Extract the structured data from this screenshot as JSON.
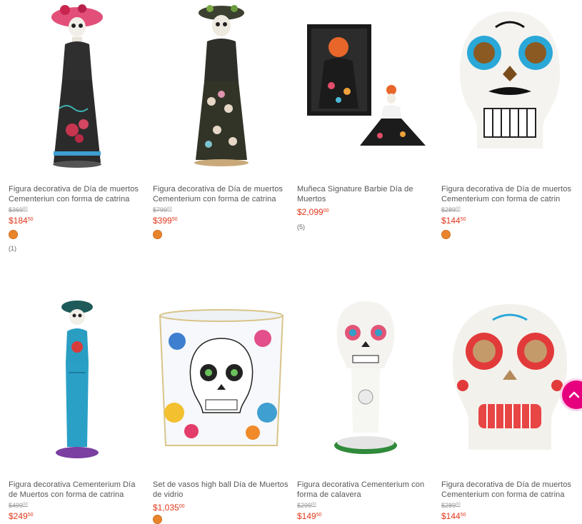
{
  "products": [
    {
      "title": "Figura decorativa de Día de muertos Cementeriun con forma de catrina",
      "old_price": "$369",
      "old_cents": "00",
      "price": "$184",
      "price_cents": "50",
      "has_swatch": true,
      "reviews": "(1)"
    },
    {
      "title": "Figura decorativa de Día de muertos Cementerium con forma de catrina",
      "old_price": "$799",
      "old_cents": "00",
      "price": "$399",
      "price_cents": "50",
      "has_swatch": true,
      "reviews": ""
    },
    {
      "title": "Muñeca Signature Barbie Día de Muertos",
      "old_price": "",
      "old_cents": "",
      "price": "$2,099",
      "price_cents": "00",
      "has_swatch": false,
      "reviews": "(5)"
    },
    {
      "title": "Figura decorativa de Día de muertos Cementerium con forma de catrin",
      "old_price": "$289",
      "old_cents": "00",
      "price": "$144",
      "price_cents": "50",
      "has_swatch": true,
      "reviews": ""
    },
    {
      "title": "Figura decorativa Cementerium Día de Muertos con forma de catrina",
      "old_price": "$499",
      "old_cents": "00",
      "price": "$249",
      "price_cents": "50",
      "has_swatch": false,
      "reviews": ""
    },
    {
      "title": "Set de vasos high ball Día de Muertos de vidrio",
      "old_price": "",
      "old_cents": "",
      "price": "$1,035",
      "price_cents": "00",
      "has_swatch": true,
      "reviews": ""
    },
    {
      "title": "Figura decorativa Cementerium con forma de calavera",
      "old_price": "$299",
      "old_cents": "00",
      "price": "$149",
      "price_cents": "50",
      "has_swatch": false,
      "reviews": ""
    },
    {
      "title": "Figura decorativa de Día de muertos Cementerium con forma de catrina",
      "old_price": "$289",
      "old_cents": "00",
      "price": "$144",
      "price_cents": "50",
      "has_swatch": false,
      "reviews": ""
    }
  ],
  "colors": {
    "price": "#e0381b",
    "swatch": "#e8842c",
    "scroll_button": "#e6007e"
  },
  "scroll_top_icon": "chevron-up-icon"
}
